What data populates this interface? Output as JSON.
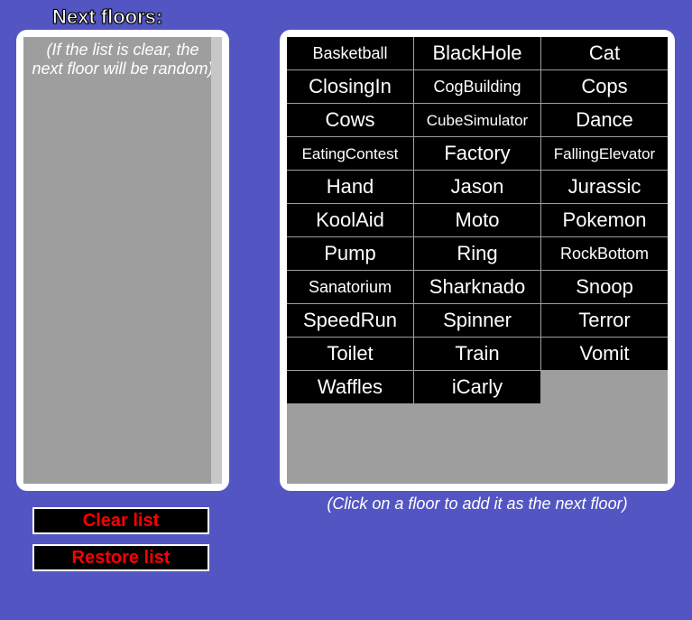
{
  "title": "Next floors:",
  "left": {
    "hint": "(If the list is clear, the next floor will be random)"
  },
  "buttons": {
    "clear": "Clear list",
    "restore": "Restore list"
  },
  "right": {
    "hint": "(Click on a floor to add it as the next floor)"
  },
  "floors": [
    "Basketball",
    "BlackHole",
    "Cat",
    "ClosingIn",
    "CogBuilding",
    "Cops",
    "Cows",
    "CubeSimulator",
    "Dance",
    "EatingContest",
    "Factory",
    "FallingElevator",
    "Hand",
    "Jason",
    "Jurassic",
    "KoolAid",
    "Moto",
    "Pokemon",
    "Pump",
    "Ring",
    "RockBottom",
    "Sanatorium",
    "Sharknado",
    "Snoop",
    "SpeedRun",
    "Spinner",
    "Terror",
    "Toilet",
    "Train",
    "Vomit",
    "Waffles",
    "iCarly"
  ]
}
